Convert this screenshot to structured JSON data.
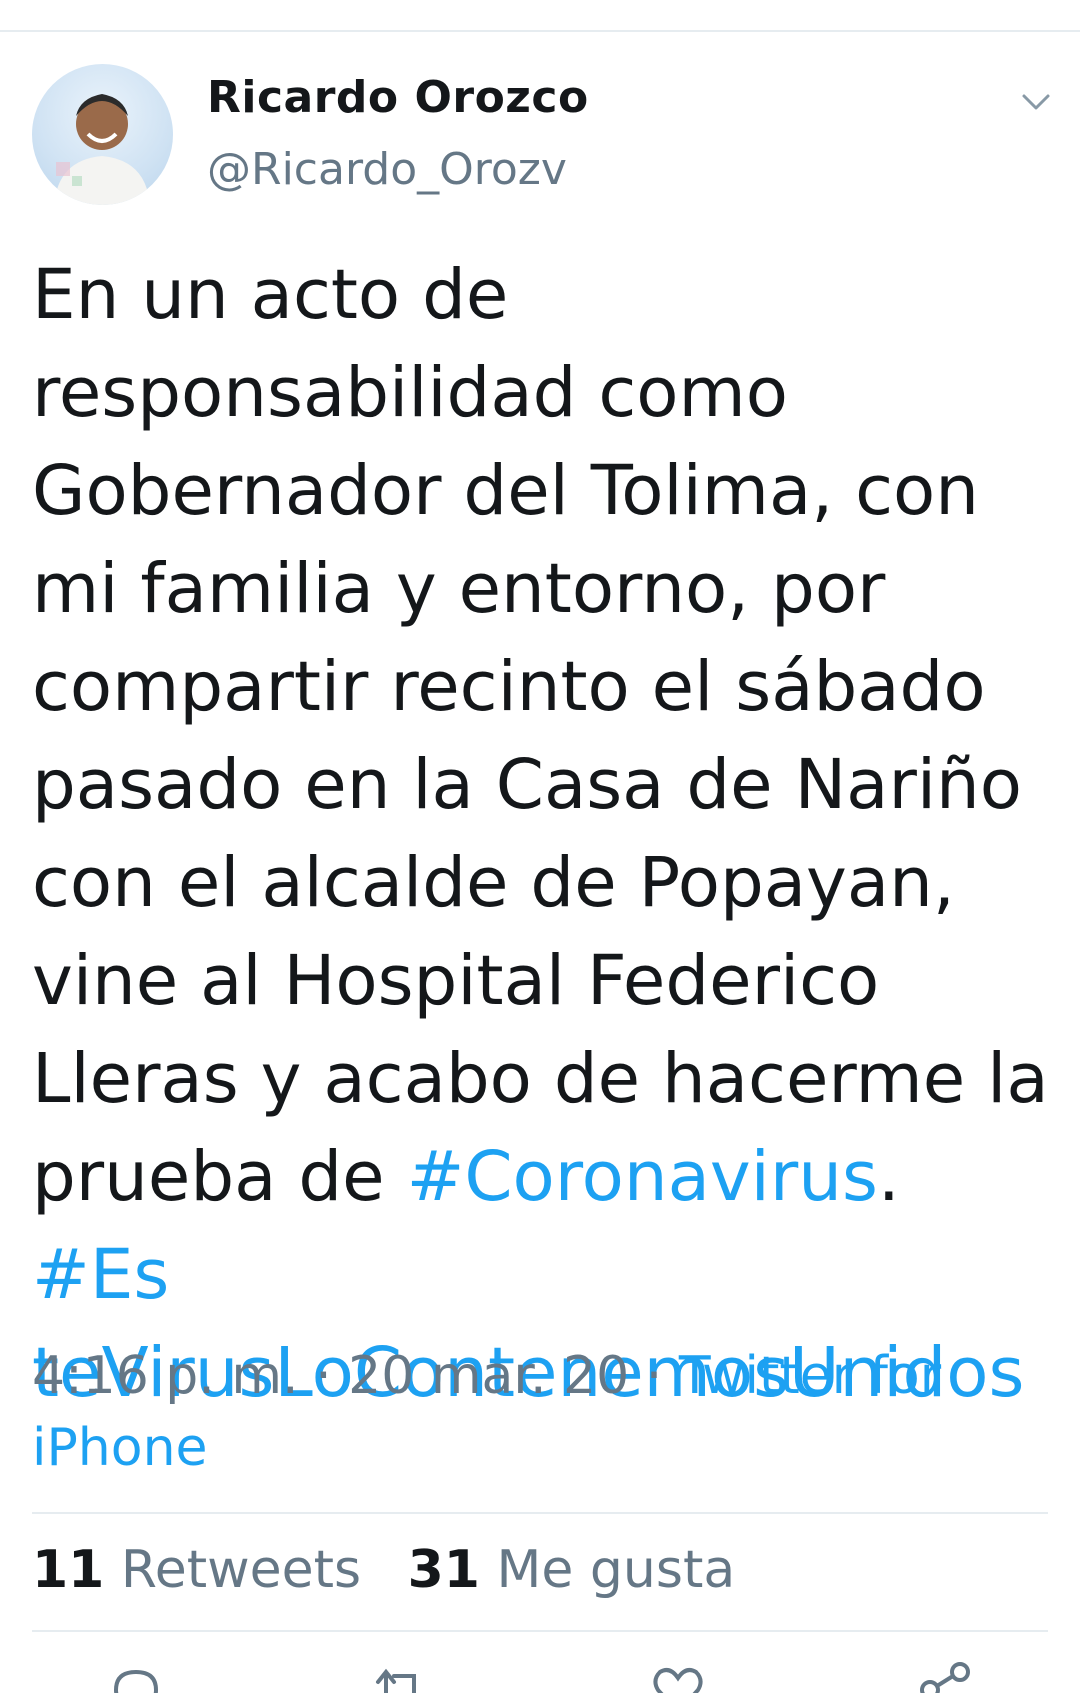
{
  "user": {
    "name": "Ricardo Orozco",
    "handle": "@Ricardo_Orozv"
  },
  "icons": {
    "caret": "chevron-down-icon",
    "reply": "reply-icon",
    "retweet": "retweet-icon",
    "like": "heart-icon",
    "share": "share-icon"
  },
  "tweet": {
    "text_before": "En un acto de responsabilidad como Gobernador del Tolima, con mi familia y entorno, por compartir recinto el sábado pasado en la Casa de Nariño con el alcalde de Popayan, vine al Hospital Federico Lleras y acabo de hacerme la prueba de ",
    "hashtag1": "#Coronavirus",
    "separator": ". ",
    "hashtag2_line1": "#Es",
    "hashtag2_line2": "teVirusLoContenemosUnidos"
  },
  "meta": {
    "time": "4:16 p. m.",
    "dot1": " · ",
    "date": "20 mar. 20",
    "dot2": " · ",
    "source_line1": "Twitter for",
    "source_line2": "iPhone"
  },
  "stats": {
    "retweets_count": "11",
    "retweets_label": "Retweets",
    "likes_count": "31",
    "likes_label": "Me gusta"
  },
  "colors": {
    "link": "#1da1f2",
    "secondary_text": "#657786",
    "primary_text": "#14171a",
    "divider": "#e6ecf0"
  }
}
